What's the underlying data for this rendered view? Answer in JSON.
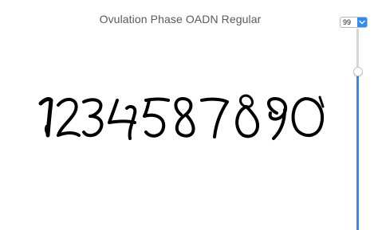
{
  "header": {
    "font_title": "Ovulation Phase OADN Regular"
  },
  "size_control": {
    "value": "99",
    "level_percent": 78,
    "arrow_icon": "chevron-down-icon",
    "accent_color": "#2f8ef4"
  },
  "preview": {
    "sample_text": "1234587890",
    "glyph_color": "#000000"
  }
}
